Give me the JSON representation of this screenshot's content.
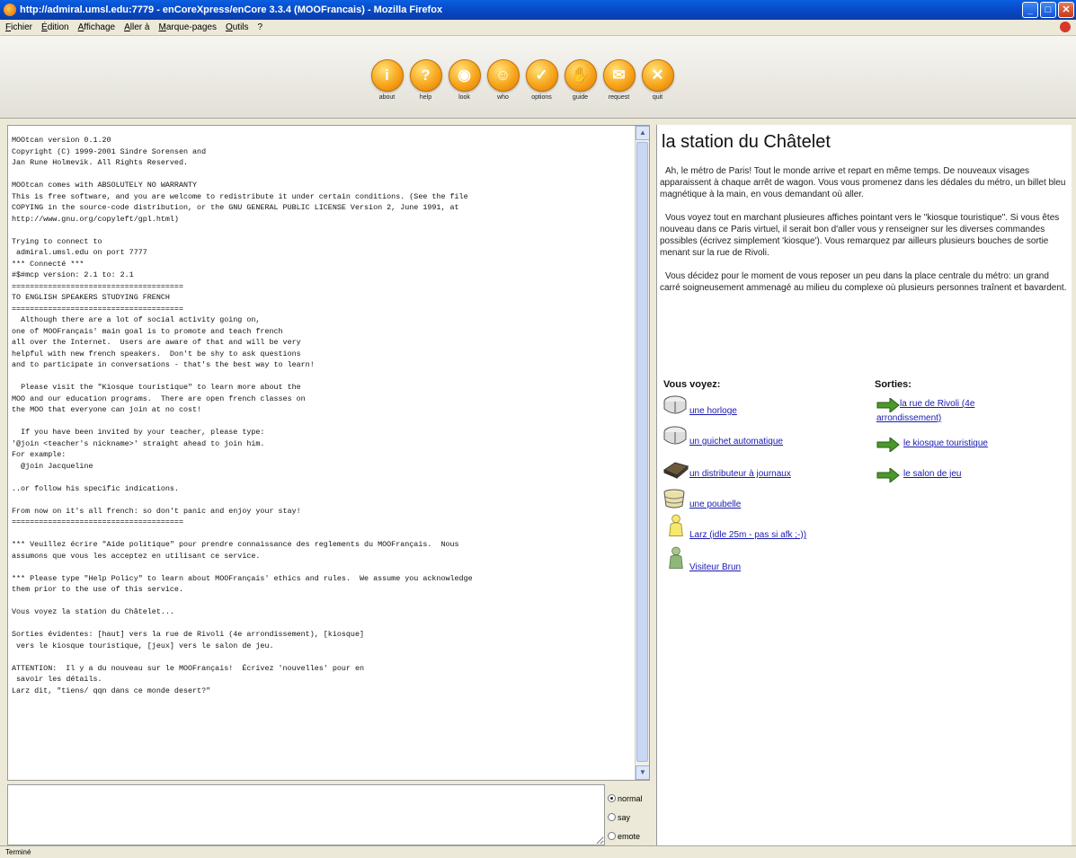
{
  "window": {
    "title": "http://admiral.umsl.edu:7779 - enCoreXpress/enCore 3.3.4 (MOOFrancais) - Mozilla Firefox"
  },
  "menu": [
    "Fichier",
    "Édition",
    "Affichage",
    "Aller à",
    "Marque-pages",
    "Outils",
    "?"
  ],
  "toolbar": [
    {
      "label": "about",
      "glyph": "i",
      "icon": "info-icon"
    },
    {
      "label": "help",
      "glyph": "?",
      "icon": "help-icon"
    },
    {
      "label": "look",
      "glyph": "◉",
      "icon": "eye-icon"
    },
    {
      "label": "who",
      "glyph": "☺",
      "icon": "face-icon"
    },
    {
      "label": "options",
      "glyph": "✓",
      "icon": "check-icon"
    },
    {
      "label": "guide",
      "glyph": "✋",
      "icon": "hand-icon"
    },
    {
      "label": "request",
      "glyph": "✉",
      "icon": "envelope-icon"
    },
    {
      "label": "quit",
      "glyph": "✕",
      "icon": "close-icon"
    }
  ],
  "console": {
    "text": "MOOtcan version 0.1.20\nCopyright (C) 1999-2001 Sindre Sorensen and\nJan Rune Holmevik. All Rights Reserved.\n\nMOOtcan comes with ABSOLUTELY NO WARRANTY\nThis is free software, and you are welcome to redistribute it under certain conditions. (See the file\nCOPYING in the source-code distribution, or the GNU GENERAL PUBLIC LICENSE Version 2, June 1991, at\nhttp://www.gnu.org/copyleft/gpl.html)\n\nTrying to connect to\n admiral.umsl.edu on port 7777\n*** Connecté ***\n#$#mcp version: 2.1 to: 2.1\n======================================\nTO ENGLISH SPEAKERS STUDYING FRENCH\n======================================\n  Although there are a lot of social activity going on,\none of MOOFrançais' main goal is to promote and teach french\nall over the Internet.  Users are aware of that and will be very\nhelpful with new french speakers.  Don't be shy to ask questions\nand to participate in conversations - that's the best way to learn!\n\n  Please visit the \"Kiosque touristique\" to learn more about the\nMOO and our education programs.  There are open french classes on\nthe MOO that everyone can join at no cost!\n\n  If you have been invited by your teacher, please type:\n'@join <teacher's nickname>' straight ahead to join him.\nFor example:\n  @join Jacqueline\n\n..or follow his specific indications.\n\nFrom now on it's all french: so don't panic and enjoy your stay!\n======================================\n\n*** Veuillez écrire \"Aide politique\" pour prendre connaissance des reglements du MOOFrançais.  Nous\nassumons que vous les acceptez en utilisant ce service.\n\n*** Please type \"Help Policy\" to learn about MOOFrançais' ethics and rules.  We assume you acknowledge\nthem prior to the use of this service.\n\nVous voyez la station du Châtelet...\n\nSorties évidentes: [haut] vers la rue de Rivoli (4e arrondissement), [kiosque]\n vers le kiosque touristique, [jeux] vers le salon de jeu.\n\nATTENTION:  Il y a du nouveau sur le MOOFrançais!  Écrivez 'nouvelles' pour en\n savoir les détails.\nLarz dit, \"tiens/ qqn dans ce monde desert?\""
  },
  "input": {
    "value": "",
    "modes": [
      {
        "label": "normal",
        "selected": true
      },
      {
        "label": "say",
        "selected": false
      },
      {
        "label": "emote",
        "selected": false
      }
    ]
  },
  "room": {
    "title": "la station du Châtelet",
    "paragraphs": [
      "Ah, le métro de Paris!  Tout le monde arrive et repart en même temps.  De nouveaux visages apparaissent à chaque arrêt de wagon.  Vous vous promenez dans les dédales du métro, un billet bleu magnétique à la main, en vous demandant où aller.",
      "Vous voyez tout en marchant plusieures affiches pointant vers le \"kiosque touristique\".  Si vous êtes nouveau dans ce Paris virtuel, il serait bon d'aller vous y renseigner sur les diverses commandes possibles (écrivez simplement 'kiosque').  Vous remarquez par ailleurs plusieurs bouches de sortie menant sur la rue de Rivoli.",
      "Vous décidez pour le moment de vous reposer un peu dans la place centrale du métro: un grand carré soigneusement ammenagé au milieu du complexe où plusieurs personnes traînent et bavardent."
    ],
    "objects_heading": "Vous voyez:",
    "exits_heading": "Sorties:",
    "objects": [
      {
        "label": "une horloge",
        "icon": "box-icon"
      },
      {
        "label": "un guichet automatique",
        "icon": "box-icon"
      },
      {
        "label": "un distributeur à journaux",
        "icon": "newspaper-icon"
      },
      {
        "label": "une poubelle",
        "icon": "trashcan-icon"
      },
      {
        "label": "Larz (idle 25m - pas si afk ;-))",
        "icon": "person-yellow-icon"
      },
      {
        "label": "Visiteur Brun",
        "icon": "person-green-icon"
      }
    ],
    "exits": [
      {
        "label": "la rue de Rivoli (4e arrondissement)"
      },
      {
        "label": "le kiosque touristique"
      },
      {
        "label": "le salon de jeu"
      }
    ]
  },
  "status": {
    "text": "Terminé"
  }
}
